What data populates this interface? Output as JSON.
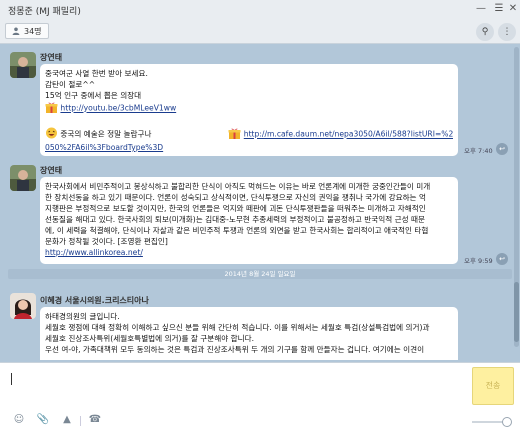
{
  "window": {
    "title": "정몽준 (MJ 패밀리)"
  },
  "header": {
    "member_count": "34명"
  },
  "messages": [
    {
      "sender": "장연태",
      "lines": [
        "중국여군 사열 한번 받아 보세요.",
        "감탄이 절로^^",
        "15억 인구 중에서 뽑은 의장대"
      ],
      "link1": "http://youtu.be/3cbMLeeV1ww",
      "line_after": "중국의 예술은 정말 놀랍구나",
      "link2a": "http://m.cafe.daum.net/nepa3050/A6il/588?listURI=%2Fnepa3",
      "link2b": "050%2FA6il%3FboardType%3D",
      "time": "오후 7:40"
    },
    {
      "sender": "장연태",
      "lines": [
        "한국사회에서 비민주적이고 봉상식하고 불합리한 단식이 아직도 먹혀드는 이유는 바로 언론계에 미개한 궁중인간들이 미개",
        "한 장치선동을 하고 있기 때문이다. 언론이 성숙되고 상식적이면, 단식투쟁으로 자신의 권익을 쟁취나 국가에 강요하는 억",
        "지행판은 부정적으로 보도할 것이지만, 한국의 언론들은 억지와 떼판에 괴돈 단식투쟁판들을 떠워주는 미개하고 자해적인",
        " 선동질을 해대고 있다. 한국사회의 퇴보(미개화)는 김대중-노무현 추종세력의 부정적이고 불공정하고 반국익적 근성 때문",
        "에, 이 세력을 척결해야, 단식이나 자살과 같은 비민주적 투쟁과 언론의 외면을 받고 한국사회는 합리적이고 애국적인 타협",
        "문화가 정착될 것이다. [조영환 편집인]"
      ],
      "link1": "http://www.allinkorea.net/",
      "time": "오후 9:59"
    },
    {
      "sender": "이혜경 서울시의원.크리스티아나",
      "lines": [
        "하태경의원의 글입니다.",
        "",
        "세월호 쟁점에 대해 정확히 이해하고 싶으신 분들 위해 간단히 적습니다. 이를 위해서는 세월호 특검(상설특검법에 의거)과",
        "세월호 진상조사특위(세월호특별법에 의거)를 잘 구분해야 합니다.",
        "우선 여-야, 가족대책위 모두 동의하는 것은 특검과 진상조사특위 두 개의 기구를 함께 만들자는 겁니다. 여기에는 이견이",
        "없습니다."
      ]
    }
  ],
  "date_divider": "2014년 8월 24일 일요일",
  "input": {
    "value": "",
    "send_label": "전송"
  },
  "icons": {
    "close": "close-icon",
    "minimize": "minimize-icon",
    "menu": "menu-icon",
    "members": "person-icon",
    "search": "search-icon",
    "emoji": "emoji-icon",
    "attach": "attach-icon",
    "image": "image-icon",
    "call": "phone-icon"
  },
  "colors": {
    "chat_background": "#b2c7d9",
    "send_button": "#fef0a0",
    "link": "#1a3c8e"
  }
}
